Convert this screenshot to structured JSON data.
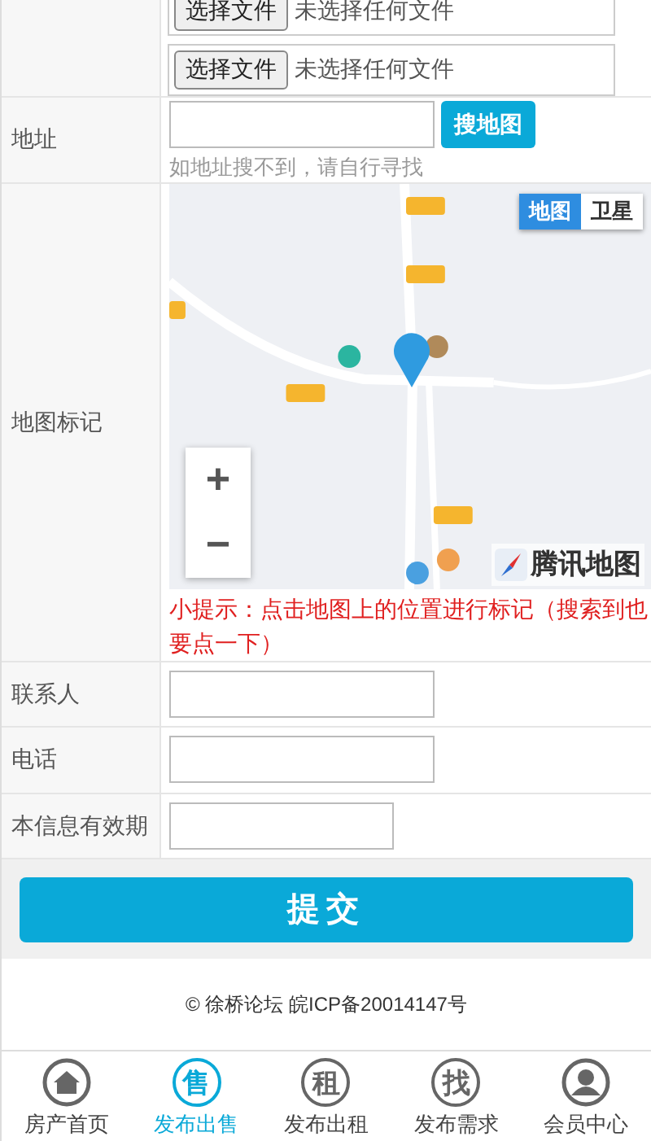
{
  "files": [
    {
      "button": "选择文件",
      "status": "未选择任何文件"
    },
    {
      "button": "选择文件",
      "status": "未选择任何文件"
    }
  ],
  "address": {
    "label": "地址",
    "button": "搜地图",
    "hint": "如地址搜不到，请自行寻找"
  },
  "map": {
    "label": "地图标记",
    "kind": "picture",
    "types": [
      {
        "label": "地图",
        "selected": true
      },
      {
        "label": "卫星",
        "selected": false
      }
    ],
    "zoom_in": "+",
    "zoom_out": "−",
    "logo": "腾讯地图",
    "tip": "小提示：点击地图上的位置进行标记（搜索到也要点一下）"
  },
  "fields": [
    {
      "label": "联系人",
      "wide": true
    },
    {
      "label": "电话",
      "wide": true
    },
    {
      "label": "本信息有效期",
      "wide": false
    }
  ],
  "submit": "提交",
  "footer": "© 徐桥论坛 皖ICP备20014147号",
  "nav": [
    {
      "kind": "home",
      "label": "房产首页",
      "selected": false
    },
    {
      "kind": "char",
      "glyph": "售",
      "label": "发布出售",
      "selected": true
    },
    {
      "kind": "char",
      "glyph": "租",
      "label": "发布出租",
      "selected": false
    },
    {
      "kind": "char",
      "glyph": "找",
      "label": "发布需求",
      "selected": false
    },
    {
      "kind": "user",
      "label": "会员中心",
      "selected": false
    }
  ]
}
